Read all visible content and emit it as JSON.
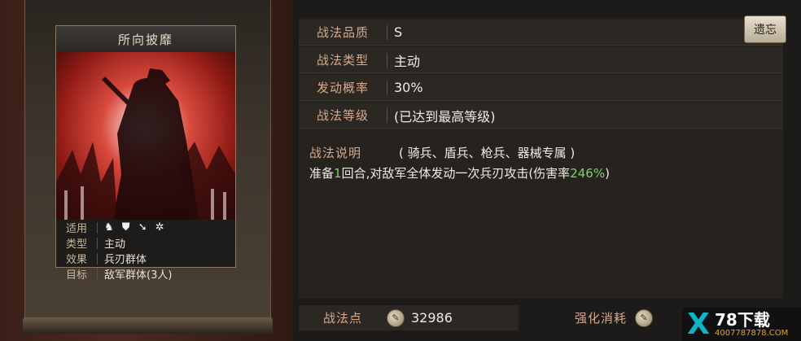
{
  "card": {
    "title": "所向披靡",
    "info": [
      {
        "key": "适用",
        "value": ""
      },
      {
        "key": "类型",
        "value": "主动"
      },
      {
        "key": "效果",
        "value": "兵刃群体"
      },
      {
        "key": "目标",
        "value": "敌军群体(3人)"
      }
    ],
    "troop_icons": [
      "cavalry-icon",
      "shield-icon",
      "spear-icon",
      "wheel-icon"
    ]
  },
  "details": {
    "quality": {
      "label": "战法品质",
      "value": "S"
    },
    "type": {
      "label": "战法类型",
      "value": "主动"
    },
    "rate": {
      "label": "发动概率",
      "value": "30%"
    },
    "level": {
      "label": "战法等级",
      "value": "(已达到最高等级)"
    }
  },
  "forget_button": "遗忘",
  "description": {
    "label": "战法说明",
    "troops": "( 骑兵、盾兵、枪兵、器械专属 )",
    "text_pre": "准备",
    "rounds": "1",
    "text_mid": "回合,对敌军全体发动一次兵刃攻击(伤害率",
    "damage_rate": "246%",
    "text_post": ")"
  },
  "footer": {
    "points_label": "战法点",
    "points_value": "32986",
    "enhance_label": "强化消耗"
  },
  "logo": {
    "mark": "X",
    "main": "78下载",
    "sub": "4007787878.COM"
  },
  "colors": {
    "accent_label": "#d8a98a",
    "highlight": "#7fd06a"
  }
}
